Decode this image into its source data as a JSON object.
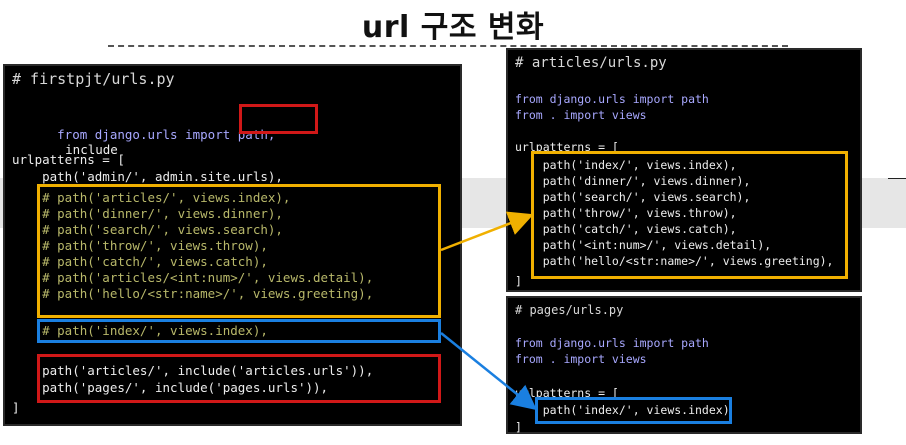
{
  "title": "url 구조 변화",
  "left": {
    "header": "# firstpjt/urls.py",
    "import_prefix": "from django.urls import path,",
    "import_include": "include",
    "urlpatterns_open": "urlpatterns = [",
    "admin_line": "    path('admin/', admin.site.urls),",
    "commented": [
      "    # path('articles/', views.index),",
      "    # path('dinner/', views.dinner),",
      "    # path('search/', views.search),",
      "    # path('throw/', views.throw),",
      "    # path('catch/', views.catch),",
      "    # path('articles/<int:num>/', views.detail),",
      "    # path('hello/<str:name>/', views.greeting),"
    ],
    "commented_index": "    # path('index/', views.index),",
    "include_lines": [
      "    path('articles/', include('articles.urls')),",
      "    path('pages/', include('pages.urls')),"
    ],
    "close": "]"
  },
  "articles": {
    "header": "# articles/urls.py",
    "import1": "from django.urls import path",
    "import2": "from . import views",
    "urlpatterns_open": "urlpatterns = [",
    "paths": [
      "    path('index/', views.index),",
      "    path('dinner/', views.dinner),",
      "    path('search/', views.search),",
      "    path('throw/', views.throw),",
      "    path('catch/', views.catch),",
      "    path('<int:num>/', views.detail),",
      "    path('hello/<str:name>/', views.greeting),"
    ],
    "close": "]"
  },
  "pages": {
    "header": "# pages/urls.py",
    "import1": "from django.urls import path",
    "import2": "from . import views",
    "urlpatterns_open": "urlpatterns = [",
    "path": "    path('index/', views.index)",
    "close": "]"
  },
  "colors": {
    "highlight_red": "#d01818",
    "highlight_yellow": "#f0b000",
    "highlight_blue": "#1a7fe0",
    "code_background": "#000000"
  }
}
